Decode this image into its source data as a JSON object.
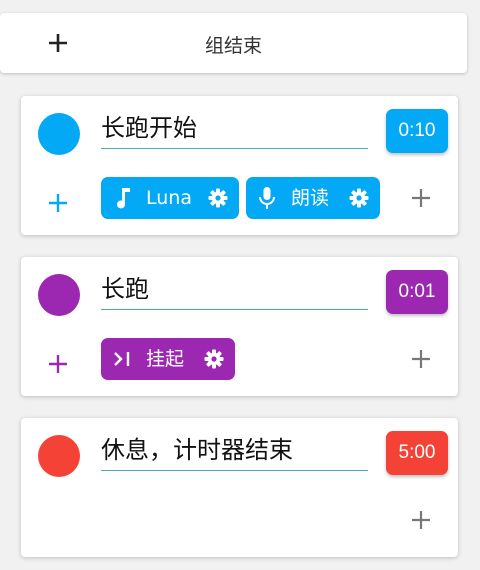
{
  "header": {
    "add_icon": "plus-icon",
    "title": "组结束"
  },
  "colors": {
    "blue": "#03a9f4",
    "purple": "#9c27b0",
    "red": "#f44336",
    "gray_plus": "#777777",
    "dark_plus": "#222222"
  },
  "steps": [
    {
      "name": "长跑开始",
      "duration": "0:10",
      "color": "#03a9f4",
      "actions": [
        {
          "label": "Luna",
          "icon": "music-note-icon",
          "settings_icon": "gear-icon"
        },
        {
          "label": "朗读",
          "icon": "microphone-icon",
          "settings_icon": "gear-icon"
        }
      ]
    },
    {
      "name": "长跑",
      "duration": "0:01",
      "color": "#9c27b0",
      "actions": [
        {
          "label": "挂起",
          "icon": "skip-next-icon",
          "settings_icon": "gear-icon"
        }
      ]
    },
    {
      "name": "休息，计时器结束",
      "duration": "5:00",
      "color": "#f44336",
      "actions": []
    }
  ]
}
